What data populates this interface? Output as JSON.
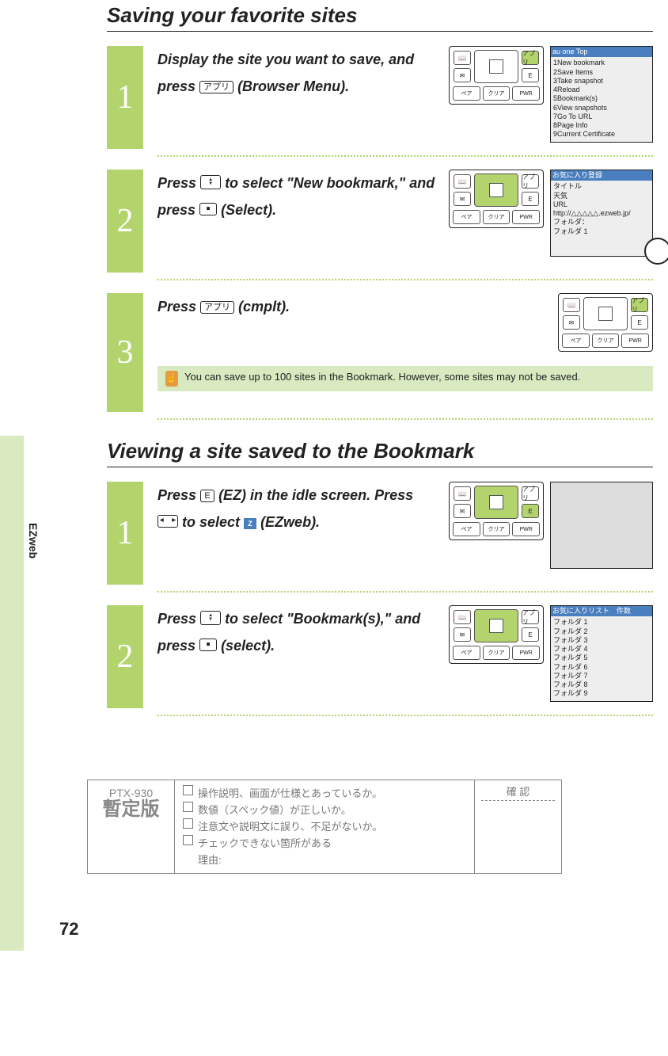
{
  "section1": {
    "title": "Saving your favorite sites"
  },
  "section2": {
    "title": "Viewing a site saved to the Bookmark"
  },
  "side_label": "EZweb",
  "page_number": "72",
  "steps1": {
    "s1": {
      "num": "1",
      "text_a": "Display the site you want to save, and press ",
      "key_apli": "アプリ",
      "text_b": " (Browser Menu).",
      "screen_head": "au one Top",
      "screen_items": [
        "1New bookmark",
        "2Save Items",
        "3Take snapshot",
        "4Reload",
        "5Bookmark(s)",
        "6View snapshots",
        "7Go To URL",
        "8Page Info",
        "9Current Certificate"
      ]
    },
    "s2": {
      "num": "2",
      "text_a": "Press ",
      "text_b": " to select \"New bookmark,\" and press ",
      "text_c": " (Select).",
      "screen_head": "お気に入り登録",
      "screen_lines": [
        "タイトル",
        "天気",
        "URL",
        "http://△△△△△.ezweb.jp/",
        "フォルダ：",
        "フォルダ 1"
      ]
    },
    "s3": {
      "num": "3",
      "text_a": "Press ",
      "key_apli": "アプリ",
      "text_b": " (cmplt).",
      "note": "You can save up to 100 sites in the Bookmark. However, some sites may not be saved."
    }
  },
  "steps2": {
    "s1": {
      "num": "1",
      "text_a": "Press ",
      "key_e": "E",
      "text_b": " (EZ) in the idle screen. Press ",
      "text_c": " to select ",
      "key_z": "Z",
      "text_d": " (EZweb)."
    },
    "s2": {
      "num": "2",
      "text_a": "Press ",
      "text_b": " to select \"Bookmark(s),\" and press ",
      "text_c": " (select).",
      "screen_head": "お気に入りリスト　件数",
      "screen_items": [
        "フォルダ 1",
        "フォルダ 2",
        "フォルダ 3",
        "フォルダ 4",
        "フォルダ 5",
        "フォルダ 6",
        "フォルダ 7",
        "フォルダ 8",
        "フォルダ 9"
      ]
    }
  },
  "keypad": {
    "book": "📖",
    "mail": "✉",
    "apli": "アプリ",
    "e": "E",
    "pair": "ペア",
    "clear": "クリア",
    "pwr": "PWR"
  },
  "review": {
    "model": "PTX-930",
    "provisional": "暫定版",
    "c1": "操作説明、画面が仕様とあっているか。",
    "c2": "数値（スペック値）が正しいか。",
    "c3": "注意文や説明文に誤り、不足がないか。",
    "c4": "チェックできない箇所がある",
    "c4b": "理由:",
    "confirm": "確 認"
  }
}
